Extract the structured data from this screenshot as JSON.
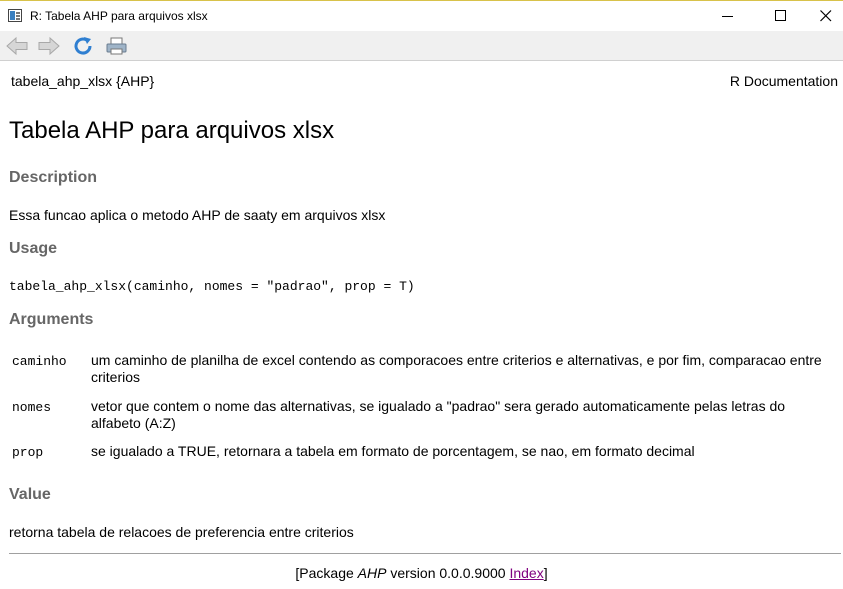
{
  "window": {
    "title": "R: Tabela AHP para arquivos xlsx",
    "controls": [
      "minimize-icon",
      "maximize-icon",
      "close-icon"
    ]
  },
  "toolbar": {
    "icons": [
      "back-arrow-icon",
      "forward-arrow-icon",
      "refresh-icon",
      "print-icon"
    ]
  },
  "doc": {
    "header_left": "tabela_ahp_xlsx {AHP}",
    "header_right": "R Documentation",
    "title": "Tabela AHP para arquivos xlsx",
    "sections": {
      "description": {
        "heading": "Description",
        "text": "Essa funcao aplica o metodo AHP de saaty em arquivos xlsx"
      },
      "usage": {
        "heading": "Usage",
        "code": "tabela_ahp_xlsx(caminho, nomes = \"padrao\", prop = T)"
      },
      "arguments": {
        "heading": "Arguments",
        "items": [
          {
            "name": "caminho",
            "desc": "um caminho de planilha de excel contendo as comporacoes entre criterios e alternativas, e por fim, comparacao entre criterios"
          },
          {
            "name": "nomes",
            "desc": "vetor que contem o nome das alternativas, se igualado a \"padrao\" sera gerado automaticamente pelas letras do alfabeto (A:Z)"
          },
          {
            "name": "prop",
            "desc": "se igualado a TRUE, retornara a tabela em formato de porcentagem, se nao, em formato decimal"
          }
        ]
      },
      "value": {
        "heading": "Value",
        "text": "retorna tabela de relacoes de preferencia entre criterios"
      }
    },
    "footer": {
      "open": "[Package ",
      "package": "AHP",
      "version_text": " version 0.0.0.9000 ",
      "index_link": "Index",
      "close": "]"
    }
  },
  "colors": {
    "heading_gray": "#666666",
    "link_visited": "#800080",
    "title_border": "#d8c24a"
  }
}
